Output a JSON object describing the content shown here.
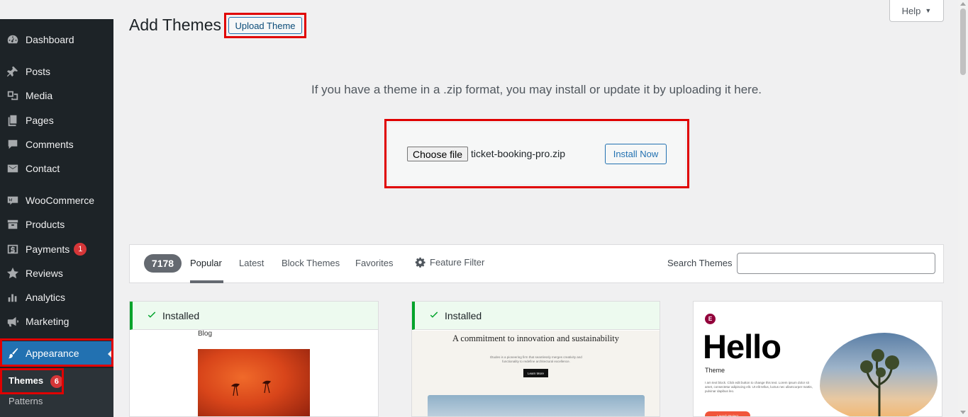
{
  "header": {
    "title": "Add Themes",
    "upload_button": "Upload Theme",
    "help_button": "Help"
  },
  "sidebar": {
    "items": [
      {
        "label": "Dashboard",
        "icon": "dashboard-icon"
      },
      {
        "label": "Posts",
        "icon": "pin-icon"
      },
      {
        "label": "Media",
        "icon": "media-icon"
      },
      {
        "label": "Pages",
        "icon": "pages-icon"
      },
      {
        "label": "Comments",
        "icon": "comment-icon"
      },
      {
        "label": "Contact",
        "icon": "envelope-icon"
      },
      {
        "label": "WooCommerce",
        "icon": "woo-icon"
      },
      {
        "label": "Products",
        "icon": "archive-icon"
      },
      {
        "label": "Payments",
        "icon": "dollar-icon",
        "badge": "1"
      },
      {
        "label": "Reviews",
        "icon": "star-icon"
      },
      {
        "label": "Analytics",
        "icon": "chart-icon"
      },
      {
        "label": "Marketing",
        "icon": "megaphone-icon"
      },
      {
        "label": "Appearance",
        "icon": "paintbrush-icon",
        "active": true
      }
    ],
    "submenu": [
      {
        "label": "Themes",
        "badge": "6",
        "current": true
      },
      {
        "label": "Patterns"
      }
    ]
  },
  "upload": {
    "description": "If you have a theme in a .zip format, you may install or update it by uploading it here.",
    "choose_file_label": "Choose file",
    "file_name": "ticket-booking-pro.zip",
    "install_button": "Install Now"
  },
  "filter_bar": {
    "count": "7178",
    "tabs": [
      "Popular",
      "Latest",
      "Block Themes",
      "Favorites"
    ],
    "active_tab": "Popular",
    "feature_filter": "Feature Filter",
    "search_label": "Search Themes",
    "search_value": ""
  },
  "themes": [
    {
      "installed_label": "Installed",
      "preview_heading": "Blog"
    },
    {
      "installed_label": "Installed",
      "preview_heading": "A commitment to innovation and sustainability",
      "preview_text": "Études is a pioneering firm that seamlessly merges creativity and functionality to redefine architectural excellence.",
      "preview_button": "Learn More"
    },
    {
      "preview_logo": "E",
      "preview_title": "Hello",
      "preview_subtitle": "Theme",
      "preview_text": "I am text block. Click edit button to change this text. Lorem ipsum dolor sit amet, consectetur adipiscing elit. Ut elit tellus, luctus nec ullamcorper mattis, pulvinar dapibus leo.",
      "preview_button": "Launch Project"
    }
  ],
  "colors": {
    "sidebar_bg": "#1d2327",
    "accent": "#2271b1",
    "badge": "#d63638",
    "installed_green": "#00a32a",
    "highlight_red": "#e00000"
  }
}
